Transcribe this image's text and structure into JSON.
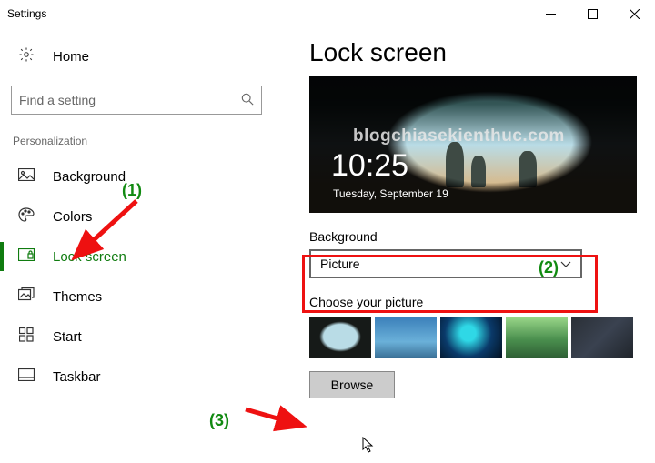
{
  "window": {
    "title": "Settings"
  },
  "sidebar": {
    "home": "Home",
    "search_placeholder": "Find a setting",
    "section": "Personalization",
    "items": [
      {
        "label": "Background"
      },
      {
        "label": "Colors"
      },
      {
        "label": "Lock screen"
      },
      {
        "label": "Themes"
      },
      {
        "label": "Start"
      },
      {
        "label": "Taskbar"
      }
    ]
  },
  "main": {
    "title": "Lock screen",
    "preview": {
      "watermark": "blogchiasekienthuc.com",
      "time": "10:25",
      "date": "Tuesday, September 19"
    },
    "background_label": "Background",
    "background_value": "Picture",
    "choose_label": "Choose your picture",
    "browse": "Browse"
  },
  "annotations": {
    "a1": "(1)",
    "a2": "(2)",
    "a3": "(3)"
  }
}
